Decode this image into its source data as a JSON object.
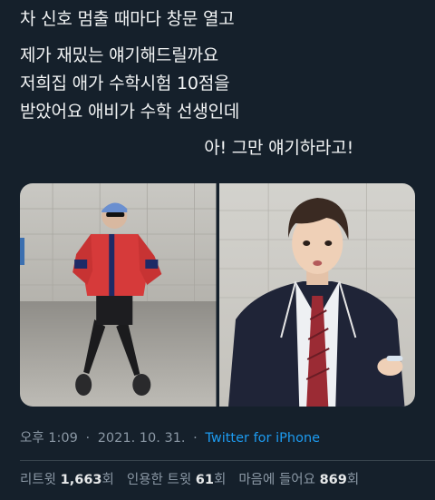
{
  "tweet": {
    "lines": [
      "차 신호 멈출 때마다 창문 열고",
      "제가 재밌는 얘기해드릴까요",
      "저희집 애가 수학시험 10점을",
      "받았어요 애비가 수학 선생인데",
      "아! 그만 얘기하라고!"
    ]
  },
  "media": {
    "photos": [
      {
        "icon": "dancer-photo"
      },
      {
        "icon": "student-photo"
      }
    ]
  },
  "meta": {
    "time": "오후 1:09",
    "separator": "·",
    "date": "2021. 10. 31.",
    "source": "Twitter for iPhone"
  },
  "stats": {
    "retweets_label": "리트윗",
    "retweets_count": "1,663",
    "retweets_unit": "회",
    "quotes_label": "인용한 트윗",
    "quotes_count": "61",
    "quotes_unit": "회",
    "likes_label": "마음에 들어요",
    "likes_count": "869",
    "likes_unit": "회"
  },
  "colors": {
    "background": "#15202b",
    "text": "#e7e9ea",
    "muted": "#8b98a5",
    "link": "#1d9bf0"
  }
}
